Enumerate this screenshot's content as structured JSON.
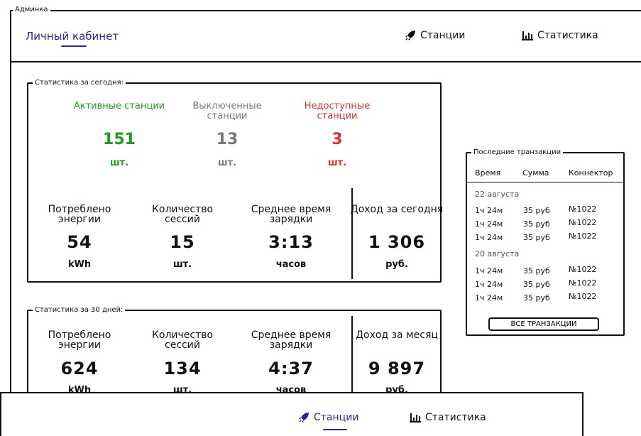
{
  "admin": {
    "legend": "Админка"
  },
  "header": {
    "cabinet": "Личный кабинет",
    "nav": [
      {
        "label": "Станции",
        "icon": "rocket-icon"
      },
      {
        "label": "Статистика",
        "icon": "bar-chart-icon"
      }
    ]
  },
  "today": {
    "legend": "Статистика за сегодня:",
    "stations": [
      {
        "label": "Активные станции",
        "value": "151",
        "unit": "шт.",
        "color": "#1f9b1f"
      },
      {
        "label": "Выключенные станции",
        "value": "13",
        "unit": "шт.",
        "color": "#777777"
      },
      {
        "label": "Недоступные станции",
        "value": "3",
        "unit": "шт.",
        "color": "#d93030"
      }
    ],
    "metrics": [
      {
        "label": "Потреблено энергии",
        "value": "54",
        "unit": "kWh"
      },
      {
        "label": "Количество сессий",
        "value": "15",
        "unit": "шт."
      },
      {
        "label": "Среднее время зарядки",
        "value": "3:13",
        "unit": "часов"
      },
      {
        "label": "Доход за сегодня",
        "value": "1 306",
        "unit": "руб."
      }
    ]
  },
  "month": {
    "legend": "Статистика за 30 дней:",
    "metrics": [
      {
        "label": "Потреблено энергии",
        "value": "624",
        "unit": "kWh"
      },
      {
        "label": "Количество сессий",
        "value": "134",
        "unit": "шт."
      },
      {
        "label": "Среднее время зарядки",
        "value": "4:37",
        "unit": "часов"
      },
      {
        "label": "Доход за месяц",
        "value": "9 897",
        "unit": "руб."
      }
    ]
  },
  "transactions": {
    "legend": "Последние транзакции",
    "headers": [
      "Время",
      "Сумма",
      "Коннектор"
    ],
    "groups": [
      {
        "date": "22 августа",
        "rows": [
          [
            "1ч 24м",
            "35 руб",
            "№1022"
          ],
          [
            "1ч 24м",
            "35 руб",
            "№1022"
          ],
          [
            "1ч 24м",
            "35 руб",
            "№1022"
          ]
        ]
      },
      {
        "date": "20 августа",
        "rows": [
          [
            "1ч 24м",
            "35 руб",
            "№1022"
          ],
          [
            "1ч 24м",
            "35 руб",
            "№1022"
          ],
          [
            "1ч 24м",
            "35 руб",
            "№1022"
          ]
        ]
      }
    ],
    "all_button": "ВСЕ ТРАНЗАКЦИИ"
  },
  "bottom_nav": [
    {
      "label": "Станции",
      "icon": "rocket-icon"
    },
    {
      "label": "Статистика",
      "icon": "bar-chart-icon"
    }
  ],
  "colors": {
    "accent": "#3a1f8f",
    "active": "#1f9b1f",
    "disabled": "#777777",
    "unavailable": "#d93030"
  }
}
